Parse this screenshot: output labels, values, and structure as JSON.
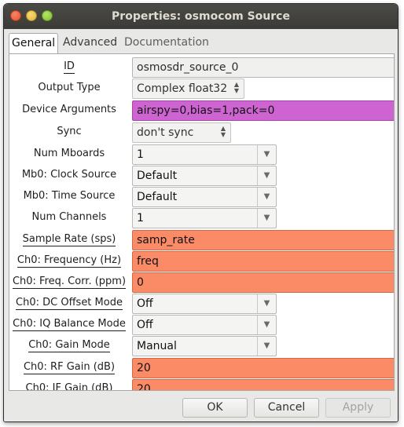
{
  "window": {
    "title": "Properties: osmocom Source"
  },
  "tabs": [
    {
      "label": "General"
    },
    {
      "label": "Advanced"
    },
    {
      "label": "Documentation"
    }
  ],
  "params": [
    {
      "label": "ID",
      "value": "osmosdr_source_0"
    },
    {
      "label": "Output Type",
      "value": "Complex float32"
    },
    {
      "label": "Device Arguments",
      "value": "airspy=0,bias=1,pack=0"
    },
    {
      "label": "Sync",
      "value": "don't sync"
    },
    {
      "label": "Num Mboards",
      "value": "1"
    },
    {
      "label": "Mb0: Clock Source",
      "value": "Default"
    },
    {
      "label": "Mb0: Time Source",
      "value": "Default"
    },
    {
      "label": "Num Channels",
      "value": "1"
    },
    {
      "label": "Sample Rate (sps)",
      "value": "samp_rate"
    },
    {
      "label": "Ch0: Frequency (Hz)",
      "value": "freq"
    },
    {
      "label": "Ch0: Freq. Corr. (ppm)",
      "value": "0"
    },
    {
      "label": "Ch0: DC Offset Mode",
      "value": "Off"
    },
    {
      "label": "Ch0: IQ Balance Mode",
      "value": "Off"
    },
    {
      "label": "Ch0: Gain Mode",
      "value": "Manual"
    },
    {
      "label": "Ch0: RF Gain (dB)",
      "value": "20"
    },
    {
      "label": "Ch0: IF Gain (dB)",
      "value": "20"
    }
  ],
  "buttons": {
    "ok": "OK",
    "cancel": "Cancel",
    "apply": "Apply"
  },
  "colors": {
    "orange_field": "#fb8a66",
    "magenta_field": "#cd64d1"
  }
}
